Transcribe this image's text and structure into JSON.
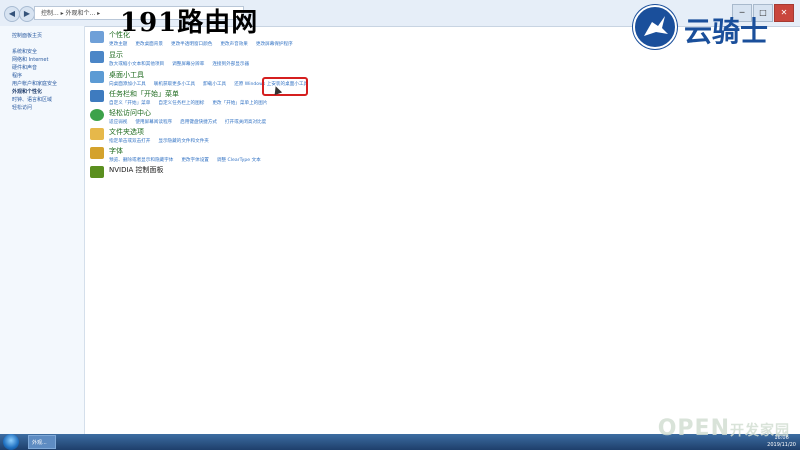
{
  "titlebar": {
    "back": "◀",
    "forward": "▶",
    "address": "控制... ▸ 外观和个... ▸",
    "minimize": "─",
    "maximize": "□",
    "close": "✕"
  },
  "watermark_191": {
    "text": "191路由网"
  },
  "logo_yunqishi": {
    "text": "云骑士"
  },
  "sidebar": {
    "home": "控制面板主页",
    "items": [
      "系统和安全",
      "网络和 Internet",
      "硬件和声音",
      "程序",
      "用户帐户和家庭安全",
      "外观和个性化",
      "时钟、语言和区域",
      "轻松访问"
    ],
    "current_index": 5
  },
  "sections": [
    {
      "title": "个性化",
      "links": [
        "更改主题",
        "更改桌面背景",
        "更改半透明窗口颜色",
        "更改声音效果",
        "更改屏幕保护程序"
      ],
      "icon_color": "#6fa0d8"
    },
    {
      "title": "显示",
      "links": [
        "放大或缩小文本和其他项目",
        "调整屏幕分辨率",
        "连接到外部显示器"
      ],
      "icon_color": "#4b86c7"
    },
    {
      "title": "桌面小工具",
      "links": [
        "向桌面添加小工具",
        "联机获取更多小工具",
        "卸载小工具",
        "还原 Windows 上安装的桌面小工具"
      ],
      "icon_color": "#5c9bd4"
    },
    {
      "title": "任务栏和「开始」菜单",
      "links": [
        "自定义「开始」菜单",
        "自定义任务栏上的图标",
        "更改「开始」菜单上的图片"
      ],
      "icon_color": "#3e7bbf"
    },
    {
      "title": "轻松访问中心",
      "links": [
        "适应弱视",
        "使用屏幕阅读程序",
        "启用键盘快捷方式",
        "打开或关闭高对比度"
      ],
      "icon_color": "#3da24a"
    },
    {
      "title": "文件夹选项",
      "links": [
        "指定单击或双击打开",
        "显示隐藏的文件和文件夹"
      ],
      "icon_color": "#e6b84a"
    },
    {
      "title": "字体",
      "links": [
        "预览、删除或者显示和隐藏字体",
        "更改字体设置",
        "调整 ClearType 文本"
      ],
      "icon_color": "#d4a22c"
    },
    {
      "title": "NVIDIA 控制面板",
      "links": [],
      "icon_color": "#5a8f1f"
    }
  ],
  "taskbar": {
    "app_label": "外观...",
    "time": "16:06",
    "date": "2019/11/20"
  },
  "open_watermark": {
    "text": "OPEN",
    "sub": "开发家园"
  }
}
